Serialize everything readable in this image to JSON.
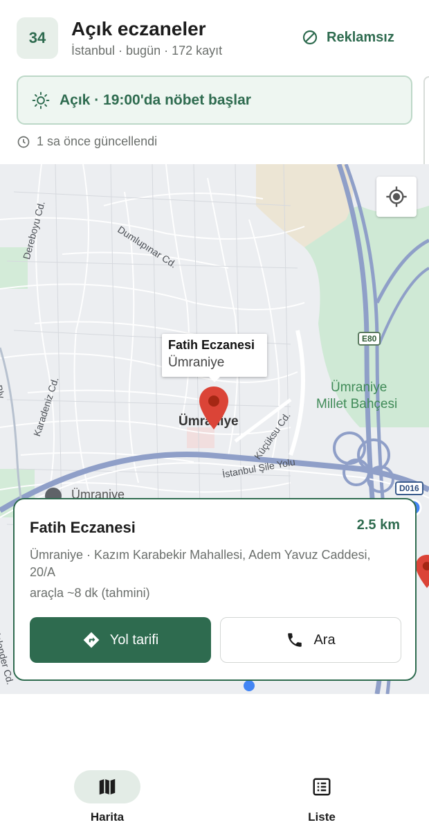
{
  "header": {
    "plate_code": "34",
    "title": "Açık eczaneler",
    "subtitle": "İstanbul · bugün · 172 kayıt",
    "ad_free_label": "Reklamsız"
  },
  "status": {
    "text": "Açık · 19:00'da nöbet başlar",
    "updated_text": "1 sa önce güncellendi"
  },
  "map": {
    "labels": {
      "dumlupinar": "Dumlupınar Cd.",
      "dereboyu": "Dereboyu Cd.",
      "bosna": "Bosna Blv.",
      "karadeniz": "Karadeniz Cd.",
      "kucuksu": "Küçüksu Cd.",
      "sile_yolu": "İstanbul Şile Yolu",
      "district": "Ümraniye",
      "millet_bahcesi_1": "Ümraniye",
      "millet_bahcesi_2": "Millet Bahçesi",
      "umraniye_lower": "Ümraniye",
      "kalender": "Kalender Cd."
    },
    "shields": {
      "e80": "E80",
      "d016": "D016"
    },
    "info_window": {
      "name": "Fatih Eczanesi",
      "area": "Ümraniye"
    },
    "colors": {
      "pin": "#db4437",
      "park": "#c9e7cf",
      "highway": "#8f9fc8"
    }
  },
  "detail": {
    "name": "Fatih Eczanesi",
    "distance": "2.5 km",
    "address": "Ümraniye · Kazım Karabekir Mahallesi, Adem Yavuz Caddesi, 20/A",
    "eta": "araçla ~8 dk (tahmini)",
    "directions_label": "Yol tarifi",
    "call_label": "Ara"
  },
  "nav": {
    "map_label": "Harita",
    "list_label": "Liste"
  },
  "theme": {
    "accent": "#2e6b4f",
    "accent_light": "#eef6f1"
  }
}
